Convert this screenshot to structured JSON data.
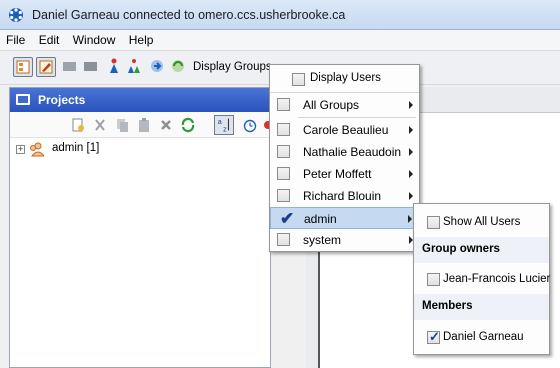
{
  "window": {
    "title": "Daniel Garneau connected to omero.ccs.usherbrooke.ca"
  },
  "menubar": {
    "items": [
      "File",
      "Edit",
      "Window",
      "Help"
    ]
  },
  "toolbar": {
    "display_groups_label": "Display Groups"
  },
  "projects_panel": {
    "title": "Projects",
    "tree": [
      {
        "label": "admin [1]",
        "expanded": false
      }
    ]
  },
  "popup_menu": {
    "display_users": {
      "label": "Display Users",
      "checked": false
    },
    "items": [
      {
        "label": "All Groups",
        "checked": false
      },
      {
        "label": "Carole Beaulieu",
        "checked": false
      },
      {
        "label": "Nathalie Beaudoin",
        "checked": false
      },
      {
        "label": "Peter Moffett",
        "checked": false
      },
      {
        "label": "Richard Blouin",
        "checked": false
      },
      {
        "label": "admin",
        "checked": true,
        "highlighted": true
      },
      {
        "label": "system",
        "checked": false
      }
    ]
  },
  "submenu": {
    "show_all_users": {
      "label": "Show All Users",
      "checked": false
    },
    "group_owners_header": "Group owners",
    "owners": [
      {
        "label": "Jean-Francois Lucier",
        "checked": false
      }
    ],
    "members_header": "Members",
    "members": [
      {
        "label": "Daniel Garneau",
        "checked": true
      }
    ]
  },
  "colors": {
    "header_blue": "#2a52bc",
    "highlight": "#c5d9f1",
    "check": "#1d3f8a"
  }
}
